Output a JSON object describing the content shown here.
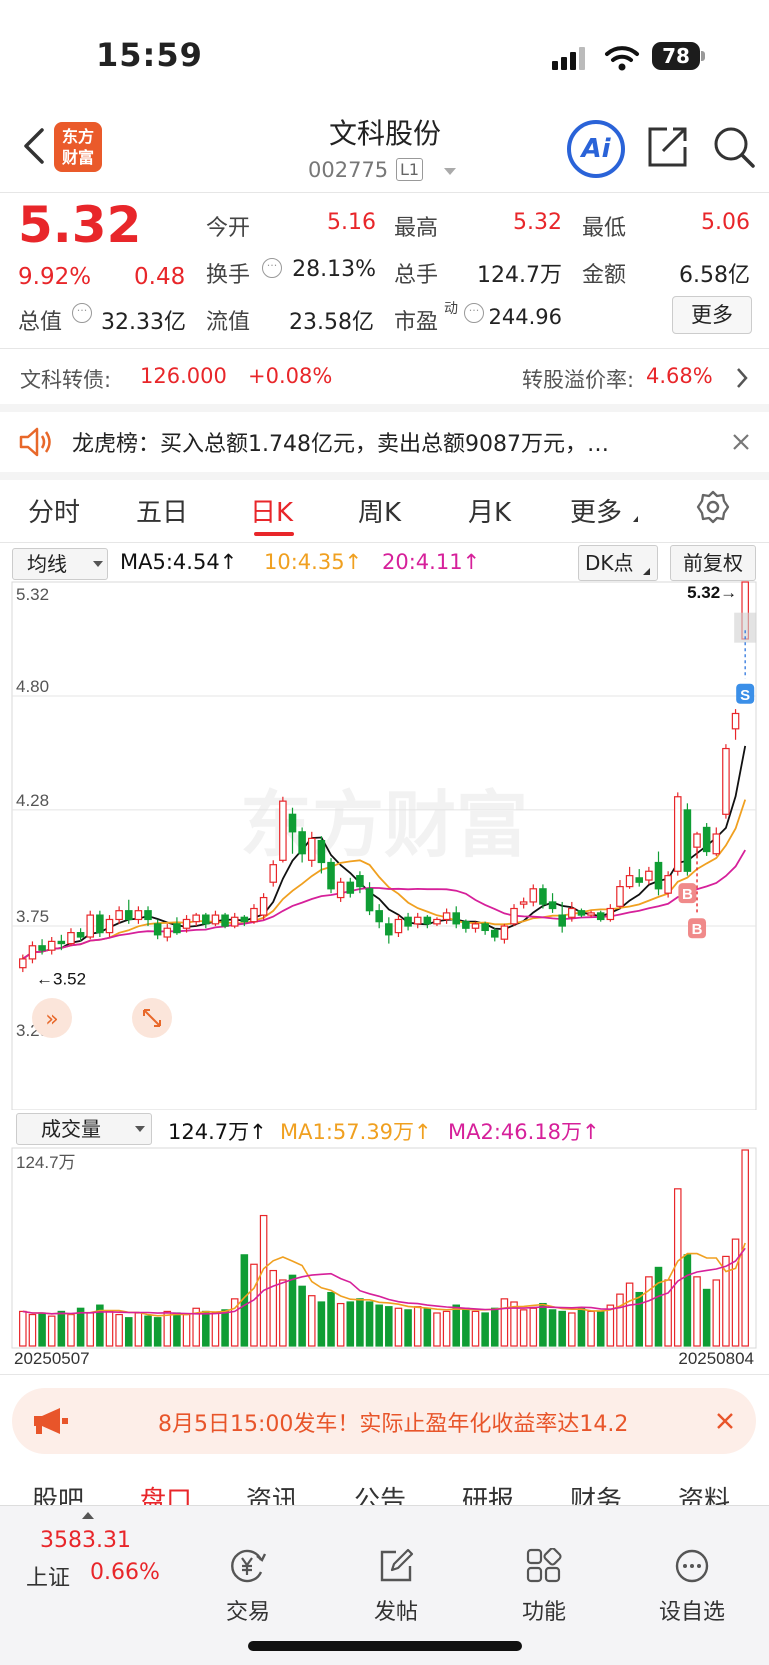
{
  "status_bar": {
    "time": "15:59",
    "battery": "78"
  },
  "header": {
    "logo_line1": "东方",
    "logo_line2": "财富",
    "stock_name": "文科股份",
    "stock_code": "002775",
    "level_badge": "L1",
    "ai_label": "Ai"
  },
  "quote": {
    "price": "5.32",
    "change_pct": "9.92%",
    "change": "0.48",
    "open_label": "今开",
    "open": "5.16",
    "high_label": "最高",
    "high": "5.32",
    "low_label": "最低",
    "low": "5.06",
    "turnover_label": "换手",
    "turnover": "28.13%",
    "volume_label": "总手",
    "volume": "124.7万",
    "amount_label": "金额",
    "amount": "6.58亿",
    "mktcap_label": "总值",
    "mktcap": "32.33亿",
    "float_label": "流值",
    "float_cap": "23.58亿",
    "pe_label": "市盈",
    "pe_sup": "动",
    "pe": "244.96",
    "more_label": "更多"
  },
  "bond": {
    "label": "文科转债:",
    "price": "126.000",
    "change": "+0.08%",
    "premium_label": "转股溢价率:",
    "premium": "4.68%"
  },
  "lhb_text": "龙虎榜：买入总额1.748亿元，卖出总额9087万元，…",
  "kline_tabs": [
    "分时",
    "五日",
    "日K",
    "周K",
    "月K",
    "更多"
  ],
  "ma_legend": {
    "select": "均线",
    "ma5": "MA5:4.54↑",
    "ma10": "10:4.35↑",
    "ma20": "20:4.11↑",
    "dk": "DK点",
    "adjust": "前复权"
  },
  "chart_labels": {
    "y_ticks": [
      "5.32",
      "4.80",
      "4.28",
      "3.75",
      "3.23"
    ],
    "high_marker": "5.32→",
    "low_marker": "←3.52",
    "watermark": "东方财富",
    "sell_tag": "S",
    "buy_tag": "B"
  },
  "volume_legend": {
    "select": "成交量",
    "vol": "124.7万↑",
    "ma1": "MA1:57.39万↑",
    "ma2": "MA2:46.18万↑",
    "max_label": "124.7万",
    "date_start": "20250507",
    "date_end": "20250804"
  },
  "chart_data": {
    "type": "candlestick",
    "y_ticks": [
      5.32,
      4.8,
      4.28,
      3.75,
      3.23
    ],
    "ylim": [
      3.23,
      5.32
    ],
    "x_start": "20250507",
    "x_end": "20250804",
    "candles": [
      [
        3.56,
        3.6,
        3.62,
        3.54
      ],
      [
        3.6,
        3.66,
        3.68,
        3.58
      ],
      [
        3.66,
        3.64,
        3.69,
        3.62
      ],
      [
        3.64,
        3.68,
        3.7,
        3.62
      ],
      [
        3.68,
        3.67,
        3.71,
        3.64
      ],
      [
        3.67,
        3.72,
        3.74,
        3.66
      ],
      [
        3.72,
        3.7,
        3.74,
        3.68
      ],
      [
        3.7,
        3.8,
        3.82,
        3.69
      ],
      [
        3.8,
        3.72,
        3.82,
        3.7
      ],
      [
        3.72,
        3.78,
        3.8,
        3.7
      ],
      [
        3.78,
        3.82,
        3.84,
        3.76
      ],
      [
        3.82,
        3.78,
        3.87,
        3.76
      ],
      [
        3.78,
        3.82,
        3.84,
        3.76
      ],
      [
        3.82,
        3.78,
        3.84,
        3.75
      ],
      [
        3.76,
        3.71,
        3.78,
        3.69
      ],
      [
        3.7,
        3.74,
        3.76,
        3.68
      ],
      [
        3.76,
        3.72,
        3.79,
        3.71
      ],
      [
        3.74,
        3.78,
        3.8,
        3.72
      ],
      [
        3.77,
        3.8,
        3.81,
        3.75
      ],
      [
        3.8,
        3.76,
        3.81,
        3.74
      ],
      [
        3.76,
        3.8,
        3.82,
        3.75
      ],
      [
        3.8,
        3.75,
        3.81,
        3.74
      ],
      [
        3.75,
        3.79,
        3.81,
        3.74
      ],
      [
        3.79,
        3.77,
        3.8,
        3.75
      ],
      [
        3.77,
        3.83,
        3.85,
        3.76
      ],
      [
        3.8,
        3.88,
        3.9,
        3.78
      ],
      [
        3.95,
        4.03,
        4.05,
        3.93
      ],
      [
        4.05,
        4.32,
        4.34,
        4.04
      ],
      [
        4.26,
        4.18,
        4.29,
        4.08
      ],
      [
        4.18,
        4.08,
        4.2,
        4.04
      ],
      [
        4.05,
        4.15,
        4.18,
        4.02
      ],
      [
        4.14,
        4.04,
        4.16,
        3.99
      ],
      [
        4.04,
        3.92,
        4.06,
        3.9
      ],
      [
        3.88,
        3.95,
        3.97,
        3.86
      ],
      [
        3.95,
        3.9,
        3.97,
        3.88
      ],
      [
        3.98,
        3.93,
        4.0,
        3.9
      ],
      [
        3.92,
        3.82,
        3.95,
        3.8
      ],
      [
        3.82,
        3.77,
        3.85,
        3.74
      ],
      [
        3.76,
        3.71,
        3.79,
        3.67
      ],
      [
        3.72,
        3.78,
        3.8,
        3.7
      ],
      [
        3.79,
        3.75,
        3.81,
        3.73
      ],
      [
        3.76,
        3.79,
        3.81,
        3.74
      ],
      [
        3.79,
        3.76,
        3.8,
        3.74
      ],
      [
        3.76,
        3.78,
        3.79,
        3.75
      ],
      [
        3.78,
        3.81,
        3.83,
        3.76
      ],
      [
        3.81,
        3.76,
        3.84,
        3.74
      ],
      [
        3.77,
        3.74,
        3.78,
        3.72
      ],
      [
        3.74,
        3.76,
        3.77,
        3.72
      ],
      [
        3.76,
        3.73,
        3.77,
        3.71
      ],
      [
        3.73,
        3.7,
        3.74,
        3.68
      ],
      [
        3.69,
        3.75,
        3.76,
        3.67
      ],
      [
        3.76,
        3.83,
        3.85,
        3.75
      ],
      [
        3.85,
        3.86,
        3.88,
        3.83
      ],
      [
        3.86,
        3.92,
        3.94,
        3.84
      ],
      [
        3.92,
        3.85,
        3.94,
        3.83
      ],
      [
        3.86,
        3.83,
        3.9,
        3.81
      ],
      [
        3.8,
        3.75,
        3.86,
        3.72
      ],
      [
        3.79,
        3.83,
        3.86,
        3.77
      ],
      [
        3.82,
        3.8,
        3.83,
        3.79
      ],
      [
        3.8,
        3.81,
        3.82,
        3.79
      ],
      [
        3.81,
        3.78,
        3.82,
        3.77
      ],
      [
        3.78,
        3.83,
        3.85,
        3.77
      ],
      [
        3.84,
        3.93,
        3.96,
        3.83
      ],
      [
        3.93,
        3.98,
        4.02,
        3.92
      ],
      [
        3.97,
        3.95,
        4.01,
        3.93
      ],
      [
        3.96,
        4.0,
        4.02,
        3.94
      ],
      [
        4.04,
        3.92,
        4.09,
        3.89
      ],
      [
        3.9,
        3.98,
        4.0,
        3.88
      ],
      [
        4.0,
        4.34,
        4.36,
        3.98
      ],
      [
        4.28,
        4.0,
        4.31,
        3.98
      ],
      [
        4.11,
        4.17,
        4.18,
        4.06
      ],
      [
        4.2,
        4.09,
        4.22,
        4.07
      ],
      [
        4.08,
        4.17,
        4.2,
        4.07
      ],
      [
        4.26,
        4.56,
        4.58,
        4.24
      ],
      [
        4.65,
        4.72,
        4.74,
        4.6
      ],
      [
        5.06,
        5.32,
        5.32,
        5.06
      ]
    ],
    "volumes": [
      22,
      20,
      21,
      19,
      22,
      20,
      24,
      21,
      26,
      22,
      20,
      18,
      21,
      19,
      18,
      22,
      21,
      20,
      24,
      22,
      21,
      23,
      30,
      58,
      52,
      83,
      48,
      42,
      45,
      38,
      32,
      28,
      34,
      27,
      28,
      30,
      28,
      26,
      25,
      24,
      23,
      25,
      24,
      21,
      22,
      26,
      24,
      22,
      21,
      24,
      30,
      28,
      23,
      24,
      27,
      23,
      22,
      21,
      24,
      22,
      22,
      26,
      33,
      40,
      34,
      44,
      50,
      42,
      100,
      58,
      44,
      36,
      42,
      57,
      68,
      124.7
    ],
    "volume_max": 124.7
  },
  "promo_text": "8月5日15:00发车！实际止盈年化收益率达14.2",
  "section_tabs": [
    "股吧",
    "盘口",
    "资讯",
    "公告",
    "研报",
    "财务",
    "资料"
  ],
  "bottom_nav": {
    "index_value": "3583.31",
    "index_name": "上证",
    "index_change": "0.66%",
    "trade": "交易",
    "post": "发帖",
    "functions": "功能",
    "watchlist": "设自选"
  }
}
